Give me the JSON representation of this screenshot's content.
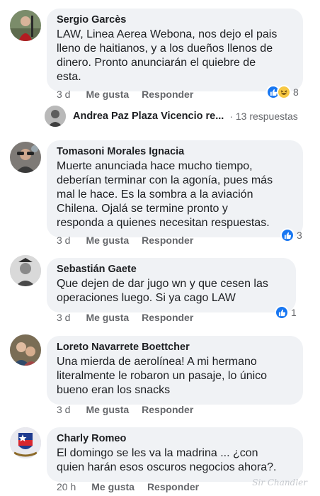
{
  "comments": [
    {
      "author": "Sergio Garcès",
      "text": "LAW, Linea Aerea Webona, nos dejo el pais\nlleno de haitianos, y a los dueños llenos de\ndinero. Pronto anunciarán el quiebre de\nesta.",
      "time": "3 d",
      "like_label": "Me gusta",
      "reply_label": "Responder",
      "reaction_count": "8",
      "reactions": [
        "like-icon",
        "haha-icon"
      ]
    },
    {
      "author": "Tomasoni Morales Ignacia",
      "text": "Muerte anunciada hace mucho tiempo,\ndeberían terminar con la agonía,  pues más\nmal le hace.  Es la sombra a la aviación\nChilena.  Ojalá se termine pronto y\nresponda a quienes necesitan respuestas.",
      "time": "3 d",
      "like_label": "Me gusta",
      "reply_label": "Responder",
      "reaction_count": "3",
      "reactions": [
        "like-icon"
      ]
    },
    {
      "author": "Sebastián Gaete",
      "text": "Que dejen de dar jugo wn y que cesen las\noperaciones luego. Si ya cago LAW",
      "time": "3 d",
      "like_label": "Me gusta",
      "reply_label": "Responder",
      "reaction_count": "1",
      "reactions": [
        "like-icon"
      ]
    },
    {
      "author": "Loreto Navarrete Boettcher",
      "text": "Una mierda de aerolínea! A mi hermano\nliteralmente le robaron un pasaje, lo único\nbueno eran los snacks",
      "time": "3 d",
      "like_label": "Me gusta",
      "reply_label": "Responder"
    },
    {
      "author": "Charly Romeo",
      "text": "El domingo se les va la madrina ... ¿con\nquien harán esos oscuros negocios ahora?.",
      "time": "20 h",
      "like_label": "Me gusta",
      "reply_label": "Responder"
    }
  ],
  "reply_preview": {
    "author": "Andrea Paz Plaza Vicencio re...",
    "count": "· 13 respuestas"
  },
  "watermark": "Sir Chandler",
  "colors": {
    "bubble": "#f0f2f5",
    "secondary_text": "#65676b",
    "like_blue": "#1877f2",
    "haha_yellow": "#f7c843"
  }
}
